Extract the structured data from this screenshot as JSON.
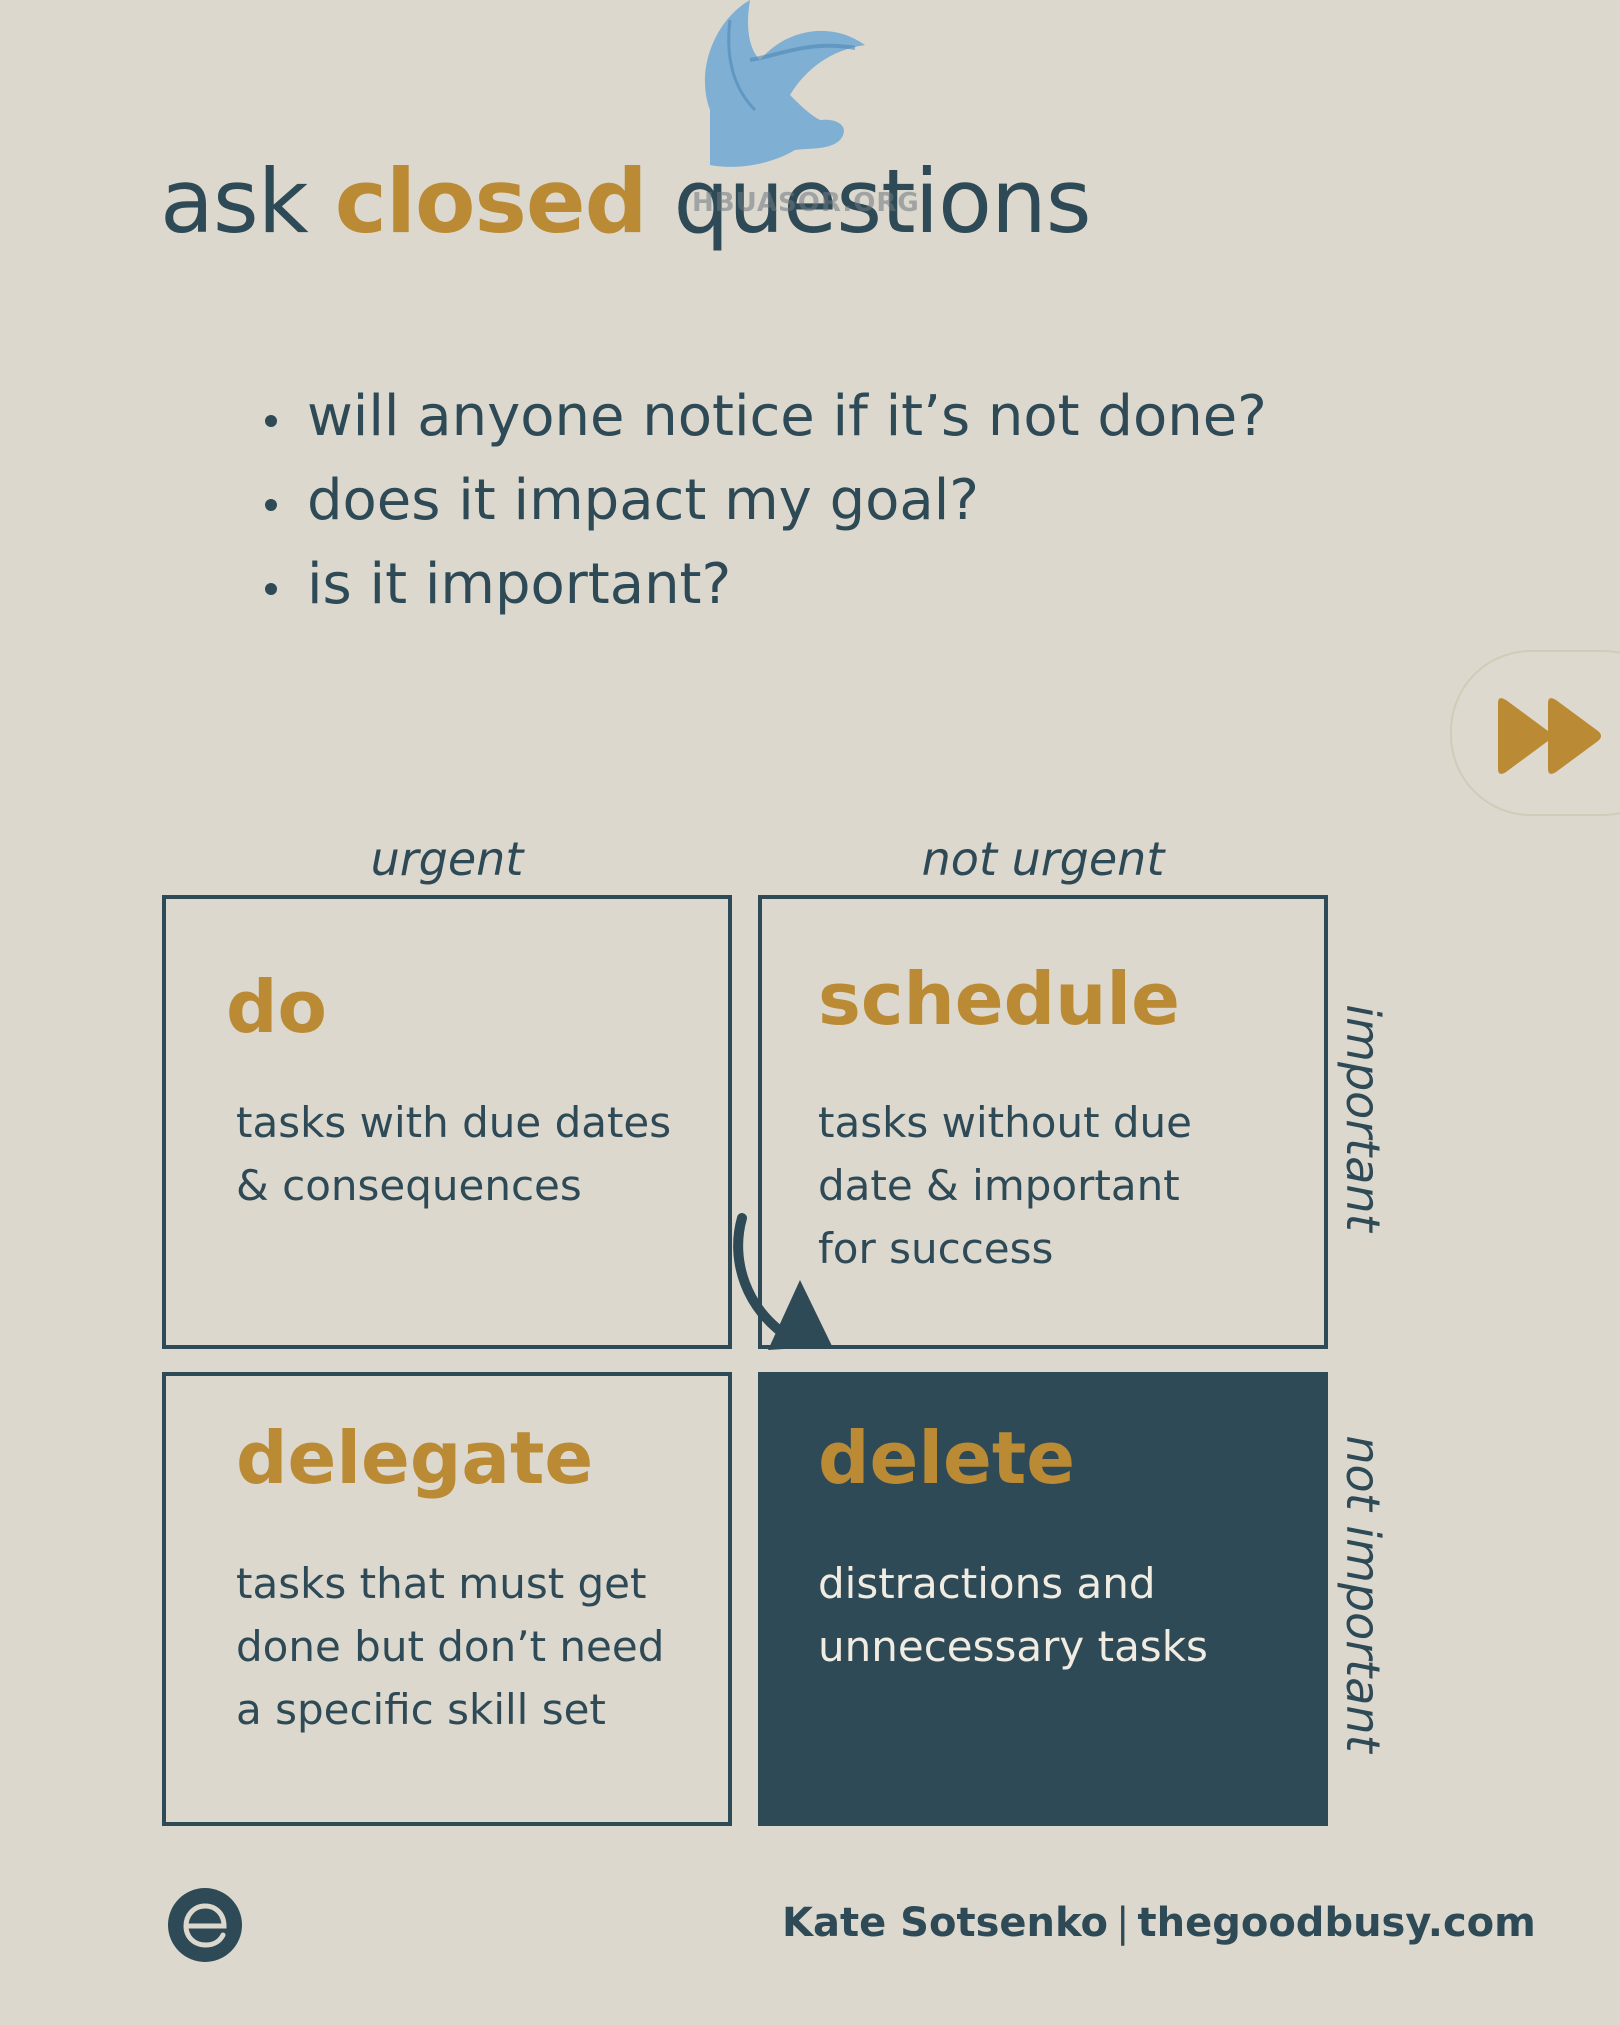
{
  "header": {
    "title_pre": "ask ",
    "title_accent": "closed",
    "title_post": " questions"
  },
  "watermark": {
    "icon": "griffin-icon",
    "text": "HBUASOR.ORG",
    "color": "#6fa8d2"
  },
  "bullets": [
    "will anyone notice if it’s not done?",
    "does it impact my goal?",
    "is it important?"
  ],
  "navigation": {
    "next_icon": "fast-forward-icon"
  },
  "matrix": {
    "columns": [
      "urgent",
      "not urgent"
    ],
    "rows": [
      "important",
      "not important"
    ],
    "cells": [
      {
        "title": "do",
        "description": "tasks with due dates\n& consequences"
      },
      {
        "title": "schedule",
        "description": "tasks without due\ndate & important\nfor success"
      },
      {
        "title": "delegate",
        "description": "tasks that must get\ndone but don’t need\na specific skill set"
      },
      {
        "title": "delete",
        "description": "distractions and\nunnecessary tasks"
      }
    ]
  },
  "footer": {
    "logo_icon": "e-logo-icon",
    "author": "Kate Sotsenko",
    "separator": "|",
    "website": "thegoodbusy.com"
  },
  "colors": {
    "background": "#ddd8cd",
    "text": "#2e4a56",
    "accent": "#bb8a34",
    "dark_cell": "#2e4a56"
  }
}
